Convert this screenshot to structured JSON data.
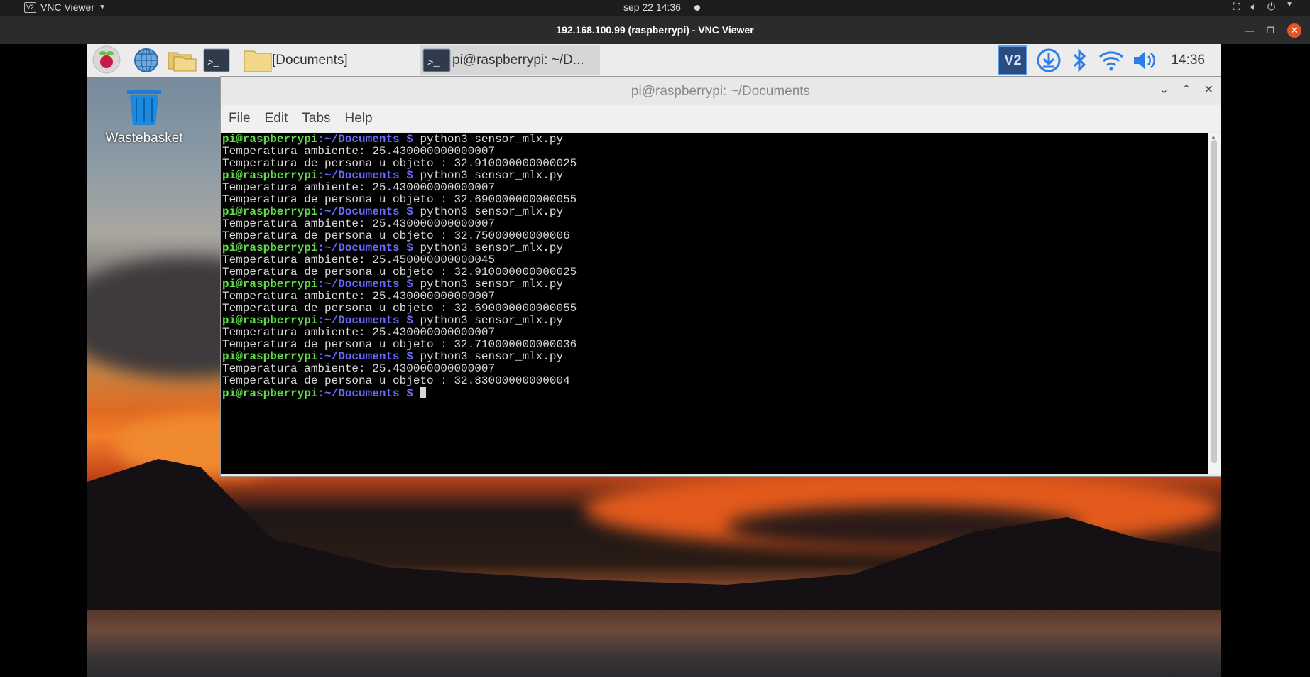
{
  "topbar": {
    "app_name": "VNC Viewer",
    "app_icon": "V2",
    "clock": "sep 22  14:36"
  },
  "vnc_window": {
    "title": "192.168.100.99 (raspberrypi) - VNC Viewer"
  },
  "panel": {
    "taskbar": [
      {
        "label": "[Documents]"
      },
      {
        "label": "pi@raspberrypi: ~/D..."
      }
    ],
    "vnc_tray_label": "V2",
    "time": "14:36"
  },
  "desktop": {
    "trash_label": "Wastebasket"
  },
  "terminal": {
    "title": "pi@raspberrypi: ~/Documents",
    "menu": [
      "File",
      "Edit",
      "Tabs",
      "Help"
    ],
    "prompt_user": "pi@raspberrypi",
    "prompt_path": ":~/Documents $",
    "lines": [
      {
        "type": "cmd",
        "text": " python3 sensor_mlx.py"
      },
      {
        "type": "out",
        "text": "Temperatura ambiente: 25.430000000000007"
      },
      {
        "type": "out",
        "text": "Temperatura de persona u objeto : 32.910000000000025"
      },
      {
        "type": "cmd",
        "text": " python3 sensor_mlx.py"
      },
      {
        "type": "out",
        "text": "Temperatura ambiente: 25.430000000000007"
      },
      {
        "type": "out",
        "text": "Temperatura de persona u objeto : 32.690000000000055"
      },
      {
        "type": "cmd",
        "text": " python3 sensor_mlx.py"
      },
      {
        "type": "out",
        "text": "Temperatura ambiente: 25.430000000000007"
      },
      {
        "type": "out",
        "text": "Temperatura de persona u objeto : 32.75000000000006"
      },
      {
        "type": "cmd",
        "text": " python3 sensor_mlx.py"
      },
      {
        "type": "out",
        "text": "Temperatura ambiente: 25.450000000000045"
      },
      {
        "type": "out",
        "text": "Temperatura de persona u objeto : 32.910000000000025"
      },
      {
        "type": "cmd",
        "text": " python3 sensor_mlx.py"
      },
      {
        "type": "out",
        "text": "Temperatura ambiente: 25.430000000000007"
      },
      {
        "type": "out",
        "text": "Temperatura de persona u objeto : 32.690000000000055"
      },
      {
        "type": "cmd",
        "text": " python3 sensor_mlx.py"
      },
      {
        "type": "out",
        "text": "Temperatura ambiente: 25.430000000000007"
      },
      {
        "type": "out",
        "text": "Temperatura de persona u objeto : 32.710000000000036"
      },
      {
        "type": "cmd",
        "text": " python3 sensor_mlx.py"
      },
      {
        "type": "out",
        "text": "Temperatura ambiente: 25.430000000000007"
      },
      {
        "type": "out",
        "text": "Temperatura de persona u objeto : 32.83000000000004"
      },
      {
        "type": "prompt",
        "text": " "
      }
    ]
  }
}
